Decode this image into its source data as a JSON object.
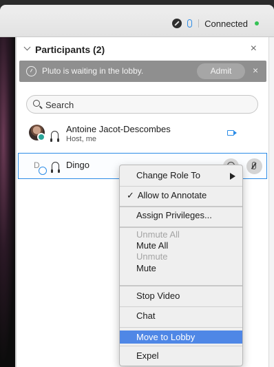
{
  "titlebar": {
    "status": "Connected"
  },
  "panel": {
    "title": "Participants (2)",
    "close": "×",
    "lobby": {
      "message": "Pluto is waiting in the lobby.",
      "admit_label": "Admit",
      "close": "×"
    },
    "search": {
      "placeholder": "Search",
      "value": ""
    },
    "participants": [
      {
        "name": "Antoine Jacot-Descombes",
        "role": "Host, me"
      },
      {
        "initial": "D",
        "name": "Dingo"
      }
    ]
  },
  "context_menu": {
    "items": [
      {
        "label": "Change Role To"
      },
      {
        "label": "Allow to Annotate",
        "check": "✓"
      },
      {
        "label": "Assign Privileges..."
      },
      {
        "label": "Unmute All"
      },
      {
        "label": "Mute All"
      },
      {
        "label": "Unmute"
      },
      {
        "label": "Mute"
      },
      {
        "label": "Stop Video"
      },
      {
        "label": "Chat"
      },
      {
        "label": "Move to Lobby"
      },
      {
        "label": "Expel"
      }
    ]
  },
  "colors": {
    "accent": "#2a8be6",
    "highlight": "#4f87e6",
    "connected": "#35c255",
    "lobby_banner": "#8f8f8f"
  }
}
